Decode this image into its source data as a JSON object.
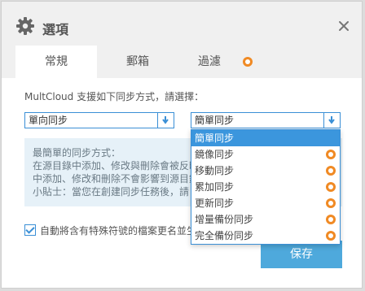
{
  "dialog": {
    "title": "選項",
    "icon": "gear-icon",
    "close_icon": "close-icon"
  },
  "tabs": [
    {
      "label": "常規",
      "active": true
    },
    {
      "label": "郵箱",
      "active": false
    },
    {
      "label": "過濾",
      "active": false,
      "premium_icon": "premium-badge-icon"
    }
  ],
  "sync": {
    "intro": "MultCloud 支援如下同步方式，請選擇：",
    "direction_select": {
      "value": "單向同步"
    },
    "mode_select": {
      "value": "簡單同步"
    },
    "options": [
      {
        "label": "簡單同步",
        "selected": true,
        "premium": false
      },
      {
        "label": "鏡像同步",
        "selected": false,
        "premium": true
      },
      {
        "label": "移動同步",
        "selected": false,
        "premium": true
      },
      {
        "label": "累加同步",
        "selected": false,
        "premium": true
      },
      {
        "label": "更新同步",
        "selected": false,
        "premium": true
      },
      {
        "label": "增量備份同步",
        "selected": false,
        "premium": true
      },
      {
        "label": "完全備份同步",
        "selected": false,
        "premium": true
      }
    ]
  },
  "info": {
    "lines": [
      "最簡單的同步方式：",
      "在源目錄中添加、修改與刪除會被反映到目標目錄中",
      "中添加、修改和刪除不會影響到源目錄。",
      "小貼士：當您在創建同步任務後，請"
    ]
  },
  "checkbox": {
    "label": "自動將含有特殊符號的檔案更名並生",
    "checked": true
  },
  "footer": {
    "save_label": "保存"
  },
  "colors": {
    "accent": "#3b96dd",
    "premium": "#f08a24",
    "button": "#4ea9dc"
  }
}
